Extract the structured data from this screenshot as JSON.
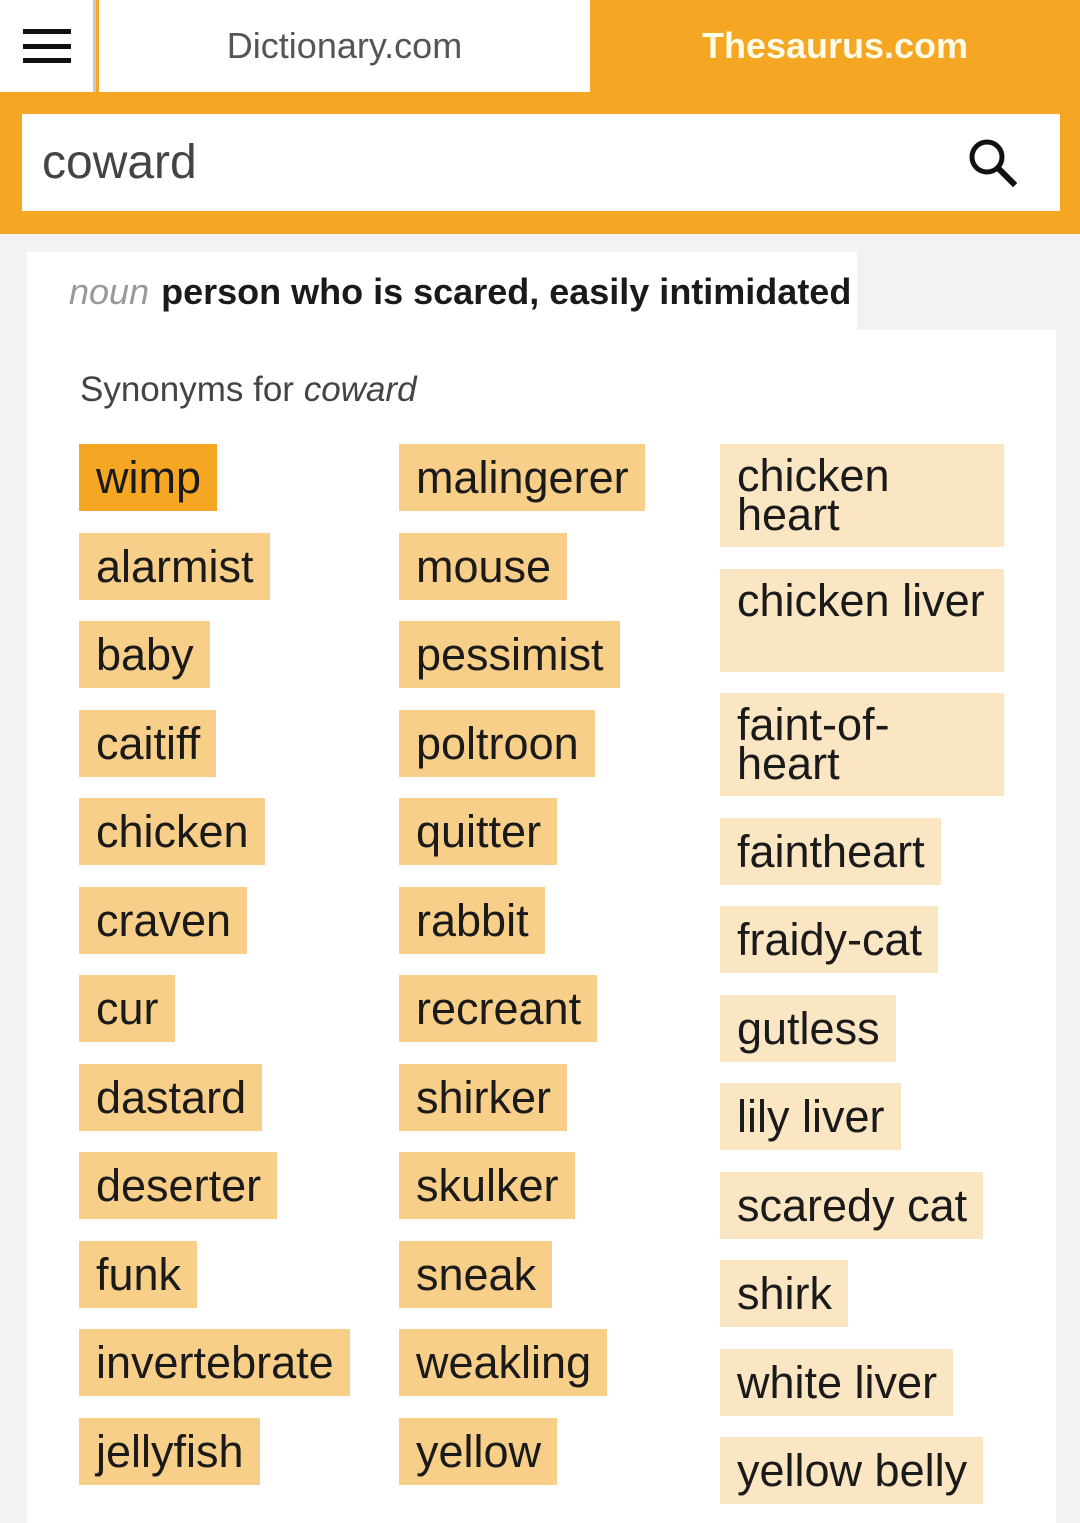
{
  "header": {
    "menu_icon": "hamburger-menu-icon",
    "tabs": [
      {
        "label": "Dictionary.com",
        "active": false
      },
      {
        "label": "Thesaurus.com",
        "active": true
      }
    ]
  },
  "search": {
    "value": "coward",
    "icon": "search-icon"
  },
  "definition": {
    "part_of_speech": "noun",
    "text": "person who is scared, easily intimidated"
  },
  "synonyms": {
    "heading_prefix": "Synonyms for",
    "heading_word": "coward",
    "column1": [
      "wimp",
      "alarmist",
      "baby",
      "caitiff",
      "chicken",
      "craven",
      "cur",
      "dastard",
      "deserter",
      "funk",
      "invertebrate",
      "jellyfish"
    ],
    "column2": [
      "malingerer",
      "mouse",
      "pessimist",
      "poltroon",
      "quitter",
      "rabbit",
      "recreant",
      "shirker",
      "skulker",
      "sneak",
      "weakling",
      "yellow"
    ],
    "column3": [
      "chicken heart",
      "chicken liver",
      "faint-of-heart",
      "faintheart",
      "fraidy-cat",
      "gutless",
      "lily liver",
      "scaredy cat",
      "shirk",
      "white liver",
      "yellow belly"
    ],
    "active": "wimp"
  },
  "colors": {
    "brand_orange": "#f5a623",
    "relevance_high": "#f8cf88",
    "relevance_low": "#fbe6c4"
  }
}
